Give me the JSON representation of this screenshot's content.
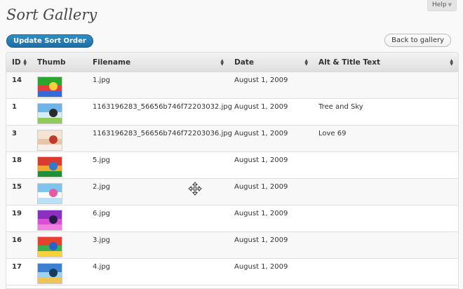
{
  "help": {
    "label": "Help"
  },
  "page": {
    "title": "Sort Gallery"
  },
  "toolbar": {
    "update_label": "Update Sort Order",
    "back_label": "Back to gallery"
  },
  "table": {
    "headers": {
      "id": "ID",
      "thumb": "Thumb",
      "filename": "Filename",
      "date": "Date",
      "alt": "Alt & Title Text"
    },
    "rows": [
      {
        "id": "14",
        "filename": "1.jpg",
        "date": "August 1, 2009",
        "alt": "",
        "thumb_colors": [
          "#2aa52e",
          "#e43d3d",
          "#f5d23a",
          "#3b67d8"
        ]
      },
      {
        "id": "1",
        "filename": "1163196283_56656b746f72203032.jpg",
        "date": "August 1, 2009",
        "alt": "Tree and Sky",
        "thumb_colors": [
          "#6fb4e6",
          "#d6ecf9",
          "#2b2b2b",
          "#8fcb5a"
        ]
      },
      {
        "id": "3",
        "filename": "1163196283_56656b746f72203036.jpg",
        "date": "August 1, 2009",
        "alt": "Love 69",
        "thumb_colors": [
          "#f4e3d3",
          "#e8c5a8",
          "#c0392b",
          "#f9efe6"
        ]
      },
      {
        "id": "18",
        "filename": "5.jpg",
        "date": "August 1, 2009",
        "alt": "",
        "thumb_colors": [
          "#d93b2f",
          "#f2a62e",
          "#2b7bd4",
          "#1f8f3a"
        ]
      },
      {
        "id": "15",
        "filename": "2.jpg",
        "date": "August 1, 2009",
        "alt": "",
        "thumb_colors": [
          "#7fc3ef",
          "#ffffff",
          "#e55aa5",
          "#b9e0f6"
        ]
      },
      {
        "id": "19",
        "filename": "6.jpg",
        "date": "August 1, 2009",
        "alt": "",
        "thumb_colors": [
          "#8a2fc2",
          "#d94fd6",
          "#2a1a4a",
          "#f27fe0"
        ]
      },
      {
        "id": "16",
        "filename": "3.jpg",
        "date": "August 1, 2009",
        "alt": "",
        "thumb_colors": [
          "#e6412f",
          "#3fae49",
          "#2b62c9",
          "#f5d33b"
        ]
      },
      {
        "id": "17",
        "filename": "4.jpg",
        "date": "August 1, 2009",
        "alt": "",
        "thumb_colors": [
          "#3d7fd0",
          "#9fd1f2",
          "#1a3a5c",
          "#f0c35a"
        ]
      }
    ]
  },
  "icons": {
    "move": "move-cursor-icon",
    "sort": "sort-arrows-icon",
    "help_caret": "caret-down-icon"
  }
}
